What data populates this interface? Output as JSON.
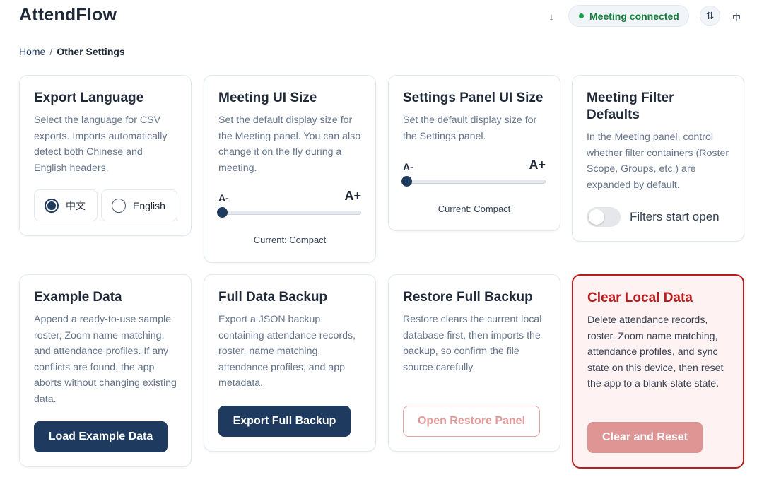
{
  "header": {
    "title": "AttendFlow",
    "download_icon": "↓",
    "status": "Meeting connected",
    "sort_icon": "⇅",
    "language_toggle": "中"
  },
  "breadcrumb": {
    "home": "Home",
    "separator": "/",
    "current": "Other Settings"
  },
  "cards": {
    "export_language": {
      "title": "Export Language",
      "description": "Select the language for CSV exports. Imports automatically detect both Chinese and English headers.",
      "options": [
        "中文",
        "English"
      ],
      "selected": "中文"
    },
    "meeting_ui_size": {
      "title": "Meeting UI Size",
      "description": "Set the default display size for the Meeting panel. You can also change it on the fly during a meeting.",
      "small_label": "A-",
      "large_label": "A+",
      "current": "Current: Compact",
      "level": 0
    },
    "settings_ui_size": {
      "title": "Settings Panel UI Size",
      "description": "Set the default display size for the Settings panel.",
      "small_label": "A-",
      "large_label": "A+",
      "current": "Current: Compact",
      "level": 0
    },
    "meeting_filter": {
      "title": "Meeting Filter Defaults",
      "description": "In the Meeting panel, control whether filter containers (Roster Scope, Groups, etc.) are expanded by default.",
      "toggle_label": "Filters start open",
      "toggle_on": false
    },
    "example_data": {
      "title": "Example Data",
      "description": "Append a ready-to-use sample roster, Zoom name matching, and attendance profiles. If any conflicts are found, the app aborts without changing existing data.",
      "button": "Load Example Data"
    },
    "full_backup": {
      "title": "Full Data Backup",
      "description": "Export a JSON backup containing attendance records, roster, name matching, attendance profiles, and app metadata.",
      "button": "Export Full Backup"
    },
    "restore_backup": {
      "title": "Restore Full Backup",
      "description": "Restore clears the current local database first, then imports the backup, so confirm the file source carefully.",
      "button": "Open Restore Panel"
    },
    "clear_local": {
      "title": "Clear Local Data",
      "description": "Delete attendance records, roster, Zoom name matching, attendance profiles, and sync state on this device, then reset the app to a blank-slate state.",
      "button": "Clear and Reset"
    }
  },
  "colors": {
    "primary": "#1e3a5f",
    "success": "#15803d",
    "danger": "#b91c1c",
    "danger_bg": "#fef2f2"
  }
}
